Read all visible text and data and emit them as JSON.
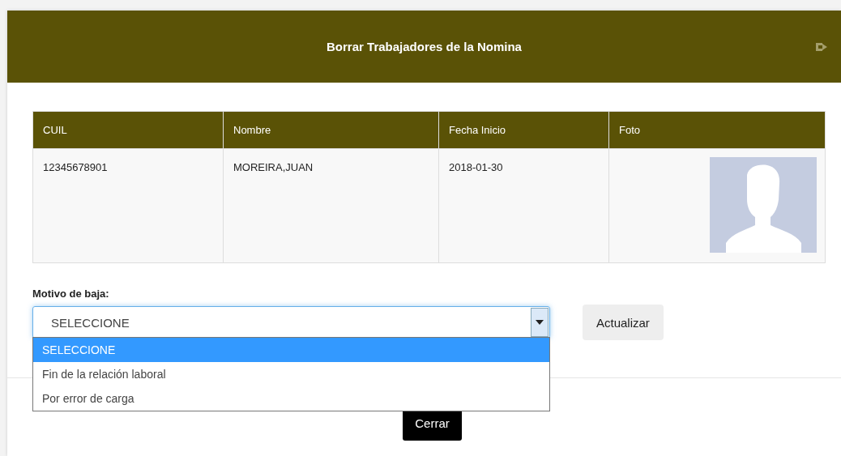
{
  "dialog": {
    "title": "Borrar Trabajadores de la Nomina"
  },
  "table": {
    "columns": [
      "CUIL",
      "Nombre",
      "Fecha Inicio",
      "Foto"
    ],
    "rows": [
      {
        "cuil": "12345678901",
        "nombre": "MOREIRA,JUAN",
        "fecha_inicio": "2018-01-30",
        "foto": {
          "kind": "avatar"
        }
      }
    ]
  },
  "reason": {
    "label": "Motivo de baja:",
    "value": "SELECCIONE",
    "expanded": true,
    "options": [
      {
        "label": "SELECCIONE",
        "selected": true
      },
      {
        "label": "Fin de la relación laboral",
        "selected": false
      },
      {
        "label": "Por error de carga",
        "selected": false
      }
    ]
  },
  "buttons": {
    "update": "Actualizar",
    "close": "Cerrar"
  }
}
